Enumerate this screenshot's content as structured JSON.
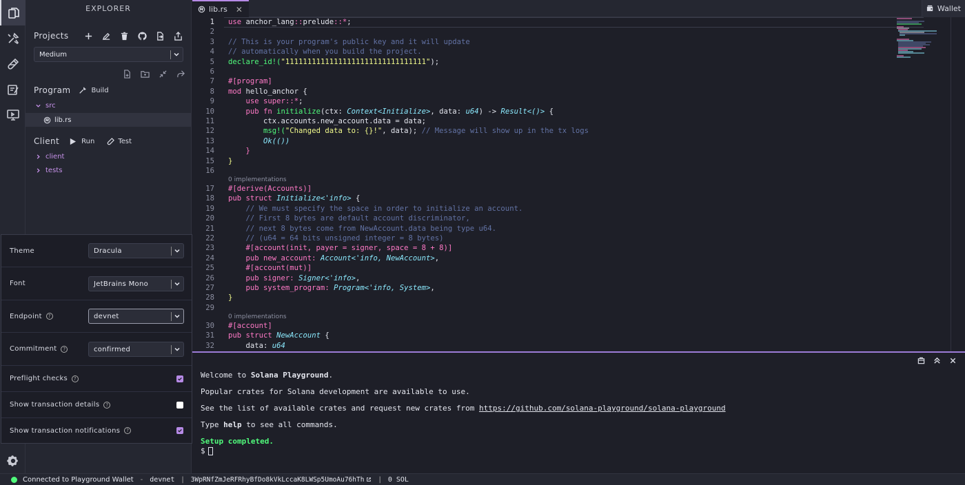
{
  "activity": {
    "items": [
      "explorer-icon",
      "build-tools-icon",
      "test-tube-icon",
      "tutorials-icon",
      "deploy-monitor-icon"
    ],
    "settings_icon": "gear-icon"
  },
  "sidebar": {
    "title": "EXPLORER",
    "projects_label": "Projects",
    "project_select": "Medium",
    "program_label": "Program",
    "build_label": "Build",
    "client_label": "Client",
    "run_label": "Run",
    "test_label": "Test",
    "tree": {
      "src_folder": "src",
      "lib_file": "lib.rs",
      "client_folder": "client",
      "tests_folder": "tests"
    }
  },
  "settings": {
    "theme_label": "Theme",
    "theme_value": "Dracula",
    "font_label": "Font",
    "font_value": "JetBrains Mono",
    "endpoint_label": "Endpoint",
    "endpoint_value": "devnet",
    "commitment_label": "Commitment",
    "commitment_value": "confirmed",
    "preflight_label": "Preflight checks",
    "preflight_checked": true,
    "tx_details_label": "Show transaction details",
    "tx_details_checked": false,
    "tx_notifications_label": "Show transaction notifications",
    "tx_notifications_checked": true
  },
  "tabs": {
    "active_tab": "lib.rs",
    "wallet_label": "Wallet"
  },
  "editor": {
    "codelens": [
      "0 implementations",
      "0 implementations"
    ],
    "line_numbers": [
      "1",
      "2",
      "3",
      "4",
      "5",
      "6",
      "7",
      "8",
      "9",
      "10",
      "11",
      "12",
      "13",
      "14",
      "15",
      "16",
      "17",
      "18",
      "19",
      "20",
      "21",
      "22",
      "23",
      "24",
      "25",
      "26",
      "27",
      "28",
      "29",
      "30",
      "31",
      "32"
    ],
    "code": {
      "l1": "use anchor_lang::prelude::*;",
      "l3": "// This is your program's public key and it will update",
      "l4": "// automatically when you build the project.",
      "l5a": "declare_id!(",
      "l5b": "\"11111111111111111111111111111111\"",
      "l5c": ");",
      "l7": "#[program]",
      "l8a": "mod",
      "l8b": " hello_anchor {",
      "l9": "    use super::*;",
      "l10a": "    pub fn ",
      "l10b": "initialize",
      "l10c": "(ctx: ",
      "l10d": "Context<Initialize>",
      "l10e": ", data: ",
      "l10f": "u64",
      "l10g": ") -> ",
      "l10h": "Result<()>",
      "l10i": " {",
      "l11": "        ctx.accounts.new_account.data = data;",
      "l12a": "        msg!(",
      "l12b": "\"Changed data to: {}!\"",
      "l12c": ", data); ",
      "l12d": "// Message will show up in the tx logs",
      "l13a": "        ",
      "l13b": "Ok(())",
      "l14": "    }",
      "l15": "}",
      "l17": "#[derive(Accounts)]",
      "l18a": "pub struct ",
      "l18b": "Initialize<'info>",
      "l18c": " {",
      "l19": "    // We must specify the space in order to initialize an account.",
      "l20": "    // First 8 bytes are default account discriminator,",
      "l21": "    // next 8 bytes come from NewAccount.data being type u64.",
      "l22": "    // (u64 = 64 bits unsigned integer = 8 bytes)",
      "l23": "    #[account(init, payer = signer, space = 8 + 8)]",
      "l24a": "    pub new_account: ",
      "l24b": "Account<'info, NewAccount>",
      "l24c": ",",
      "l25": "    #[account(mut)]",
      "l26a": "    pub signer: ",
      "l26b": "Signer<'info>",
      "l26c": ",",
      "l27a": "    pub system_program: ",
      "l27b": "Program<'info, System>",
      "l27c": ",",
      "l28": "}",
      "l30": "#[account]",
      "l31a": "pub struct ",
      "l31b": "NewAccount",
      "l31c": " {",
      "l32a": "    data: ",
      "l32b": "u64"
    }
  },
  "terminal": {
    "welcome_prefix": "Welcome to ",
    "welcome_bold": "Solana Playground",
    "welcome_suffix": ".",
    "crates_line": "Popular crates for Solana development are available to use.",
    "list_prefix": "See the list of available crates and request new crates from ",
    "list_url": "https://github.com/solana-playground/solana-playground",
    "help_prefix": "Type ",
    "help_bold": "help",
    "help_suffix": " to see all commands.",
    "setup_line": "Setup completed.",
    "prompt": "$"
  },
  "statusbar": {
    "connection": "Connected to Playground Wallet",
    "dash": "-",
    "network": "devnet",
    "sep": "|",
    "address": "3WpRNfZmJeRFRhyBfDo8kVkLccaK8LWSp5UmoAu76hTh",
    "balance": "0 SOL"
  },
  "colors": {
    "accent": "#b68ae6",
    "connected": "#50fa7b",
    "background": "#1e1f28"
  }
}
